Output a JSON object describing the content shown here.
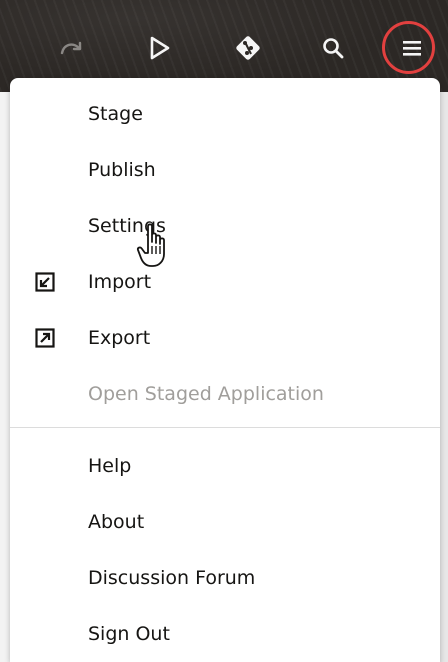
{
  "toolbar": {
    "icons": {
      "redo": "redo-icon",
      "run": "play-icon",
      "git": "git-icon",
      "search": "search-icon",
      "menu": "hamburger-menu-icon"
    },
    "colors": {
      "background": "#2c2825",
      "icon": "#f5f5f5",
      "highlight_ring": "#e2403f"
    }
  },
  "menu": {
    "items": [
      {
        "label": "Stage",
        "icon": "",
        "enabled": true
      },
      {
        "label": "Publish",
        "icon": "",
        "enabled": true
      },
      {
        "label": "Settings",
        "icon": "",
        "enabled": true
      },
      {
        "label": "Import",
        "icon": "import-icon",
        "enabled": true
      },
      {
        "label": "Export",
        "icon": "export-icon",
        "enabled": true
      },
      {
        "label": "Open Staged Application",
        "icon": "",
        "enabled": false
      },
      {
        "label": "Help",
        "icon": "",
        "enabled": true
      },
      {
        "label": "About",
        "icon": "",
        "enabled": true
      },
      {
        "label": "Discussion Forum",
        "icon": "",
        "enabled": true
      },
      {
        "label": "Sign Out",
        "icon": "",
        "enabled": true
      }
    ]
  },
  "cursor": {
    "icon": "hand-pointer-icon"
  }
}
